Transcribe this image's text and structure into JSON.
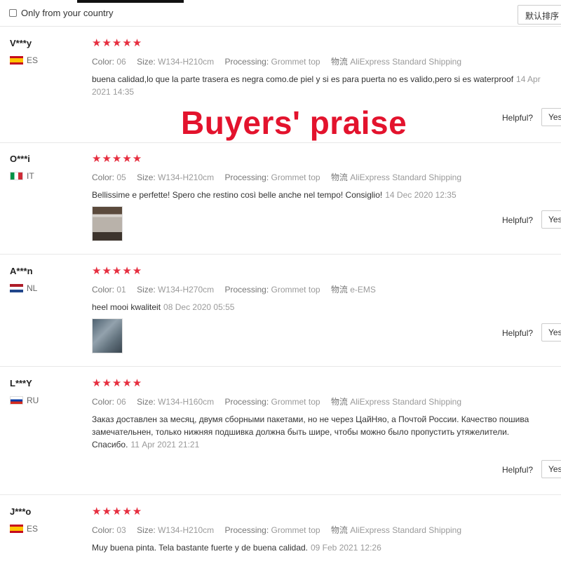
{
  "filter": {
    "checkbox_label": "Only from your country",
    "sort_label": "默认排序"
  },
  "overlay_title": "Buyers' praise",
  "labels": {
    "color": "Color:",
    "size": "Size:",
    "processing": "Processing:",
    "shipping": "物流",
    "helpful": "Helpful?",
    "yes": "Yes"
  },
  "rating_stars": "★★★★★",
  "colors": {
    "star": "#e62e3f",
    "overlay": "#e3132d"
  },
  "reviews": [
    {
      "user": "V***y",
      "country": "ES",
      "color": "06",
      "size": "W134-H210cm",
      "processing": "Grommet top",
      "shipping": "AliExpress Standard Shipping",
      "comment": "buena calidad,lo que la parte trasera es negra como.de piel y si es para puerta no es valido,pero si es waterproof",
      "date": "14 Apr 2021 14:35"
    },
    {
      "user": "O***i",
      "country": "IT",
      "color": "05",
      "size": "W134-H210cm",
      "processing": "Grommet top",
      "shipping": "AliExpress Standard Shipping",
      "comment": "Bellissime e perfette! Spero che restino così belle anche nel tempo! Consiglio!",
      "date": "14 Dec 2020 12:35"
    },
    {
      "user": "A***n",
      "country": "NL",
      "color": "01",
      "size": "W134-H270cm",
      "processing": "Grommet top",
      "shipping": "e-EMS",
      "comment": "heel mooi kwaliteit",
      "date": "08 Dec 2020 05:55"
    },
    {
      "user": "L***Y",
      "country": "RU",
      "color": "06",
      "size": "W134-H160cm",
      "processing": "Grommet top",
      "shipping": "AliExpress Standard Shipping",
      "comment": "Заказ доставлен за месяц, двумя сборными пакетами, но не через ЦайНяо, а Почтой России. Качество пошива замечательнен, только нижняя подшивка должна быть шире, чтобы можно было пропустить утяжелители. Спасибо.",
      "date": "11 Apr 2021 21:21"
    },
    {
      "user": "J***o",
      "country": "ES",
      "color": "03",
      "size": "W134-H210cm",
      "processing": "Grommet top",
      "shipping": "AliExpress Standard Shipping",
      "comment": "Muy buena pinta. Tela bastante fuerte y de buena calidad.",
      "date": "09 Feb 2021 12:26"
    }
  ]
}
